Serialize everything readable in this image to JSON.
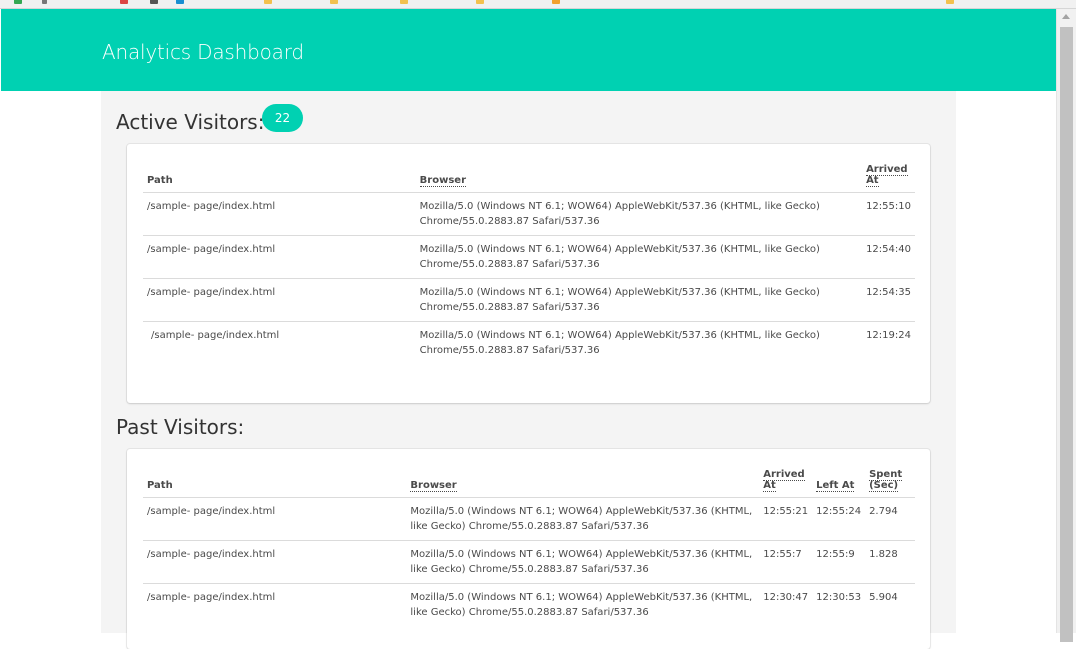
{
  "header": {
    "title": "Analytics Dashboard"
  },
  "active": {
    "heading": "Active Visitors:",
    "count": "22",
    "columns": {
      "path": "Path",
      "browser": "Browser",
      "arrived": "Arrived At"
    },
    "rows": [
      {
        "path": "/sample- page/index.html",
        "browser": "Mozilla/5.0 (Windows NT 6.1; WOW64) AppleWebKit/537.36 (KHTML, like Gecko) Chrome/55.0.2883.87 Safari/537.36",
        "arrived": "12:55:10"
      },
      {
        "path": "/sample- page/index.html",
        "browser": "Mozilla/5.0 (Windows NT 6.1; WOW64) AppleWebKit/537.36 (KHTML, like Gecko) Chrome/55.0.2883.87 Safari/537.36",
        "arrived": "12:54:40"
      },
      {
        "path": "/sample- page/index.html",
        "browser": "Mozilla/5.0 (Windows NT 6.1; WOW64) AppleWebKit/537.36 (KHTML, like Gecko) Chrome/55.0.2883.87 Safari/537.36",
        "arrived": "12:54:35"
      },
      {
        "path": "/sample- page/index.html",
        "browser": "Mozilla/5.0 (Windows NT 6.1; WOW64) AppleWebKit/537.36 (KHTML, like Gecko) Chrome/55.0.2883.87 Safari/537.36",
        "arrived": "12:19:24"
      }
    ]
  },
  "past": {
    "heading": "Past Visitors:",
    "columns": {
      "path": "Path",
      "browser": "Browser",
      "arrived": "Arrived At",
      "left": "Left At",
      "spent": "Spent (Sec)"
    },
    "rows": [
      {
        "path": "/sample- page/index.html",
        "browser": "Mozilla/5.0 (Windows NT 6.1; WOW64) AppleWebKit/537.36 (KHTML, like Gecko) Chrome/55.0.2883.87 Safari/537.36",
        "arrived": "12:55:21",
        "left": "12:55:24",
        "spent": "2.794"
      },
      {
        "path": "/sample- page/index.html",
        "browser": "Mozilla/5.0 (Windows NT 6.1; WOW64) AppleWebKit/537.36 (KHTML, like Gecko) Chrome/55.0.2883.87 Safari/537.36",
        "arrived": "12:55:7",
        "left": "12:55:9",
        "spent": "1.828"
      },
      {
        "path": "/sample- page/index.html",
        "browser": "Mozilla/5.0 (Windows NT 6.1; WOW64) AppleWebKit/537.36 (KHTML, like Gecko) Chrome/55.0.2883.87 Safari/537.36",
        "arrived": "12:30:47",
        "left": "12:30:53",
        "spent": "5.904"
      }
    ]
  },
  "colors": {
    "accent": "#00d1b2",
    "page_bg": "#f4f4f4",
    "card_bg": "#ffffff"
  }
}
